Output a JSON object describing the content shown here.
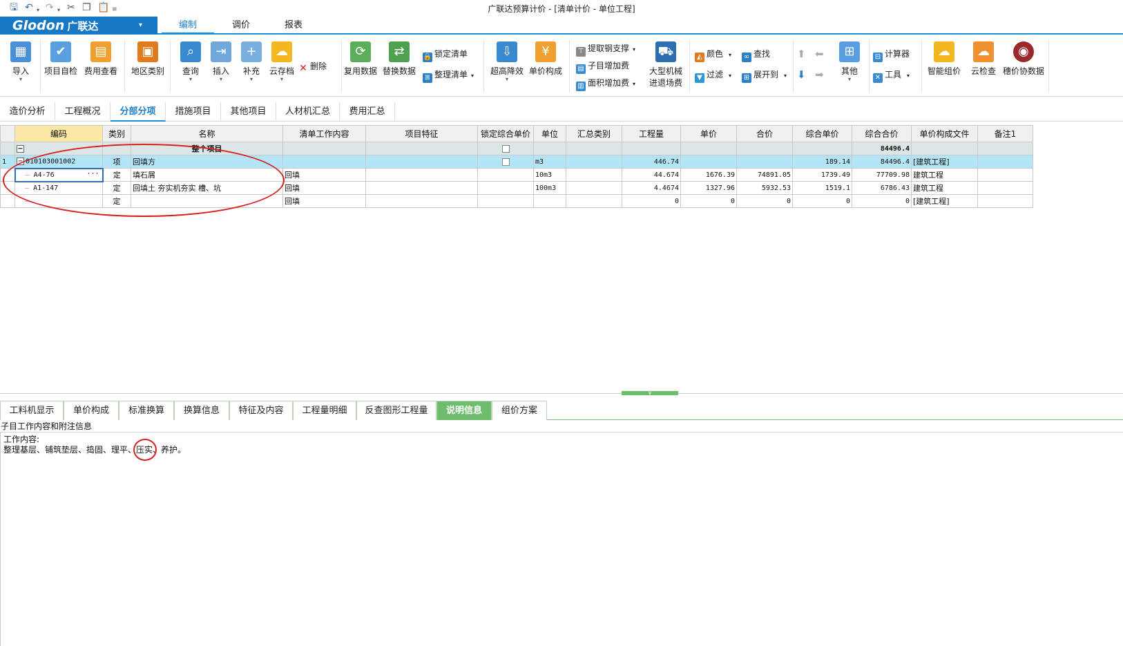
{
  "window": {
    "title": "广联达预算计价 - [清单计价 - 单位工程]"
  },
  "quick_access": [
    "save-icon",
    "undo-icon",
    "redo-icon",
    "cut-icon",
    "copy-icon",
    "paste-icon",
    "customize-icon"
  ],
  "logo": {
    "brand": "Glodon",
    "cn": "广联达",
    "dropdown": "▾"
  },
  "menu": [
    "编制",
    "调价",
    "报表"
  ],
  "ribbon": {
    "import": "导入",
    "self_check": "项目自检",
    "fee_view": "费用查看",
    "region": "地区类别",
    "query": "查询",
    "insert": "插入",
    "supplement": "补充",
    "cloud_save": "云存档",
    "delete": "删除",
    "reuse_data": "复用数据",
    "replace_data": "替换数据",
    "lock_list": "锁定清单",
    "organize_list": "整理清单",
    "elevation": "超高降效",
    "unit_price_comp": "单价构成",
    "steel_support": "提取钢支撑",
    "sub_extra": "子目增加费",
    "area_extra": "面积增加费",
    "big_machine_1": "大型机械",
    "big_machine_2": "进退场费",
    "color": "颜色",
    "find": "查找",
    "filter": "过滤",
    "expand": "展开到",
    "other": "其他",
    "calculator": "计算器",
    "tools": "工具",
    "smart_price": "智能组价",
    "cloud_check": "云检查",
    "guangxie": "穗价协数据"
  },
  "tabs": [
    "造价分析",
    "工程概况",
    "分部分项",
    "措施项目",
    "其他项目",
    "人材机汇总",
    "费用汇总"
  ],
  "active_tab": "分部分项",
  "grid": {
    "headers": [
      "编码",
      "类别",
      "名称",
      "清单工作内容",
      "项目特征",
      "锁定综合单价",
      "单位",
      "汇总类别",
      "工程量",
      "单价",
      "合价",
      "综合单价",
      "综合合价",
      "单价构成文件",
      "备注1"
    ],
    "whole": {
      "name": "整个项目",
      "total": "84496.4"
    },
    "rows": [
      {
        "no": "1",
        "code": "010103001002",
        "type": "项",
        "name": "回填方",
        "work": "",
        "feature": "",
        "unit": "m3",
        "summary": "",
        "qty": "446.74",
        "price": "",
        "amount": "",
        "comp_price": "189.14",
        "comp_amount": "84496.4",
        "file": "[建筑工程]",
        "note": ""
      },
      {
        "no": "",
        "code": "A4-76",
        "type": "定",
        "name": "填石屑",
        "work": "回填",
        "feature": "",
        "unit": "10m3",
        "summary": "",
        "qty": "44.674",
        "price": "1676.39",
        "amount": "74891.05",
        "comp_price": "1739.49",
        "comp_amount": "77709.98",
        "file": "建筑工程",
        "note": ""
      },
      {
        "no": "",
        "code": "A1-147",
        "type": "定",
        "name": "回填土 夯实机夯实 槽、坑",
        "work": "回填",
        "feature": "",
        "unit": "100m3",
        "summary": "",
        "qty": "4.4674",
        "price": "1327.96",
        "amount": "5932.53",
        "comp_price": "1519.1",
        "comp_amount": "6786.43",
        "file": "建筑工程",
        "note": ""
      },
      {
        "no": "",
        "code": "",
        "type": "定",
        "name": "",
        "work": "回填",
        "feature": "",
        "unit": "",
        "summary": "",
        "qty": "0",
        "price": "0",
        "amount": "0",
        "comp_price": "0",
        "comp_amount": "0",
        "file": "[建筑工程]",
        "note": ""
      }
    ],
    "cell_button": "···"
  },
  "bottom_tabs": [
    "工料机显示",
    "单价构成",
    "标准换算",
    "换算信息",
    "特征及内容",
    "工程量明细",
    "反查图形工程量",
    "说明信息",
    "组价方案"
  ],
  "active_bottom_tab": "说明信息",
  "info": {
    "header": "子目工作内容和附注信息",
    "line1": "工作内容:",
    "line2": "整理基层、铺筑垫层、捣固、理平、压实、养护。"
  },
  "colors": {
    "accent": "#1d8fd8",
    "logo_bg": "#1779c6",
    "green_tab": "#6dbd6d",
    "item_row": "#b3e5f7",
    "annotation": "#d62020"
  }
}
